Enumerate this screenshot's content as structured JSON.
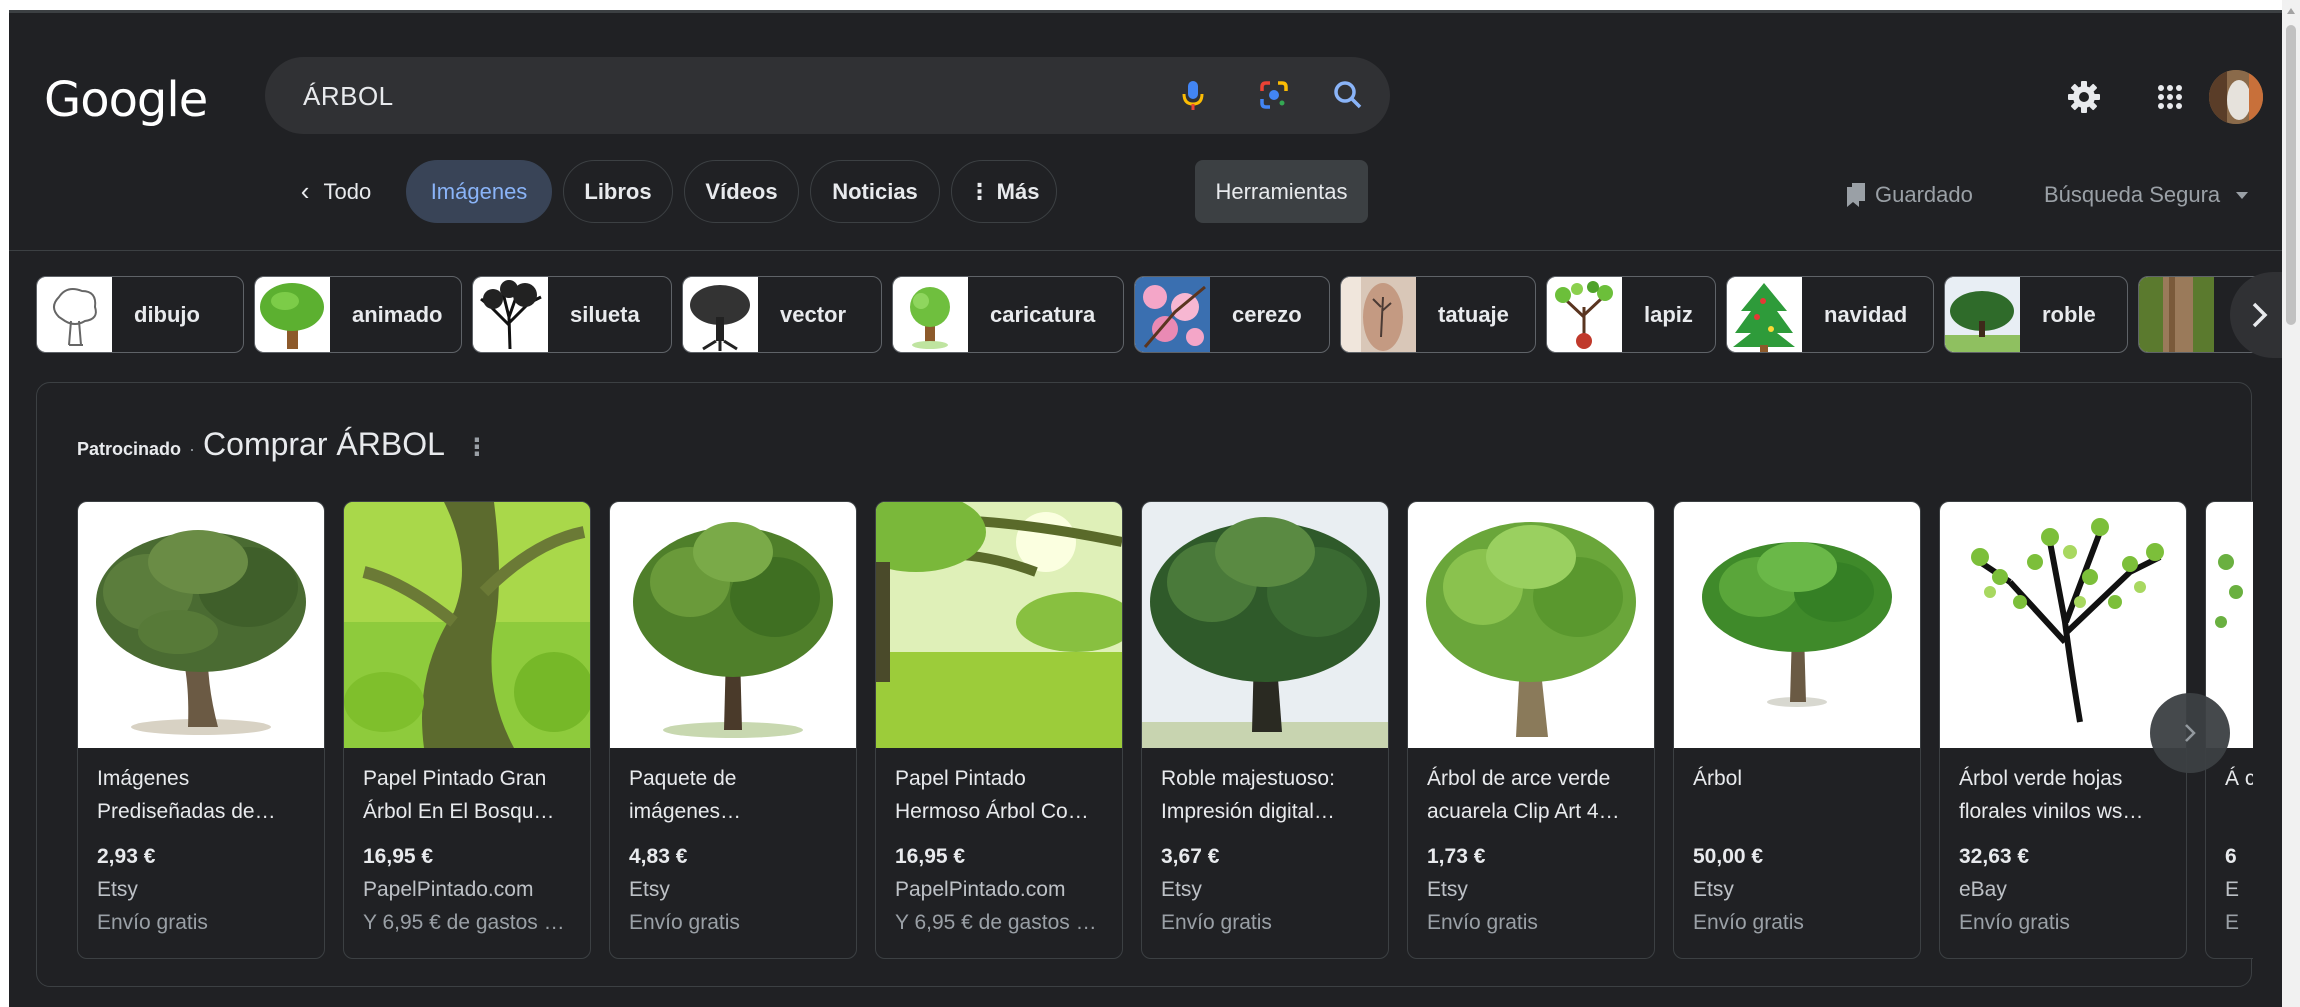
{
  "header": {
    "logo": "Google",
    "query": "ÁRBOL",
    "icons": [
      "mic-icon",
      "google-lens-icon",
      "search-icon",
      "gear-icon",
      "apps-grid-icon"
    ]
  },
  "tabs": {
    "back_label": "Todo",
    "items": [
      "Imágenes",
      "Libros",
      "Vídeos",
      "Noticias",
      "⋮ Más"
    ],
    "active": "Imágenes",
    "tools_label": "Herramientas",
    "saved_label": "Guardado",
    "safe_search_label": "Búsqueda Segura"
  },
  "chips": [
    "dibujo",
    "animado",
    "silueta",
    "vector",
    "caricatura",
    "cerezo",
    "tatuaje",
    "lapiz",
    "navidad",
    "roble"
  ],
  "sponsored": {
    "tag": "Patrocinado",
    "separator": "·",
    "title": "Comprar ÁRBOL",
    "products": [
      {
        "name": "Imágenes Prediseñadas de…",
        "price": "2,93 €",
        "store": "Etsy",
        "shipping": "Envío gratis"
      },
      {
        "name": "Papel Pintado Gran Árbol En El Bosqu…",
        "price": "16,95 €",
        "store": "PapelPintado.com",
        "shipping": "Y 6,95 € de gastos …"
      },
      {
        "name": "Paquete de imágenes…",
        "price": "4,83 €",
        "store": "Etsy",
        "shipping": "Envío gratis"
      },
      {
        "name": "Papel Pintado Hermoso Árbol Co…",
        "price": "16,95 €",
        "store": "PapelPintado.com",
        "shipping": "Y 6,95 € de gastos …"
      },
      {
        "name": "Roble majestuoso: Impresión digital…",
        "price": "3,67 €",
        "store": "Etsy",
        "shipping": "Envío gratis"
      },
      {
        "name": "Árbol de arce verde acuarela Clip Art 4…",
        "price": "1,73 €",
        "store": "Etsy",
        "shipping": "Envío gratis"
      },
      {
        "name": "Árbol",
        "price": "50,00 €",
        "store": "Etsy",
        "shipping": "Envío gratis"
      },
      {
        "name": "Árbol verde hojas florales vinilos ws…",
        "price": "32,63 €",
        "store": "eBay",
        "shipping": "Envío gratis"
      },
      {
        "name": "Á c",
        "price": "6",
        "store": "E",
        "shipping": "E"
      }
    ]
  },
  "colors": {
    "background": "#202124",
    "search_bg": "#303134",
    "active_tab_bg": "#394457",
    "active_tab_text": "#8ab4f8",
    "tree_green": "#4caf50"
  }
}
